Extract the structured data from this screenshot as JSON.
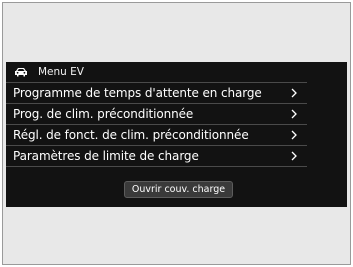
{
  "header": {
    "title": "Menu EV",
    "icon": "car-icon"
  },
  "menu": {
    "items": [
      {
        "label": "Programme de temps d'attente en charge",
        "icon": "chevron-right-icon"
      },
      {
        "label": "Prog. de clim. préconditionnée",
        "icon": "chevron-right-icon"
      },
      {
        "label": "Régl. de fonct. de clim. préconditionnée",
        "icon": "chevron-right-icon"
      },
      {
        "label": "Paramètres de limite de charge",
        "icon": "chevron-right-icon"
      }
    ]
  },
  "action": {
    "open_charge_cover_label": "Ouvrir couv. charge"
  },
  "colors": {
    "screen_background": "#121212",
    "text": "#ffffff",
    "button_background": "#3a3a3a",
    "outer_background": "#e8e8e8"
  }
}
